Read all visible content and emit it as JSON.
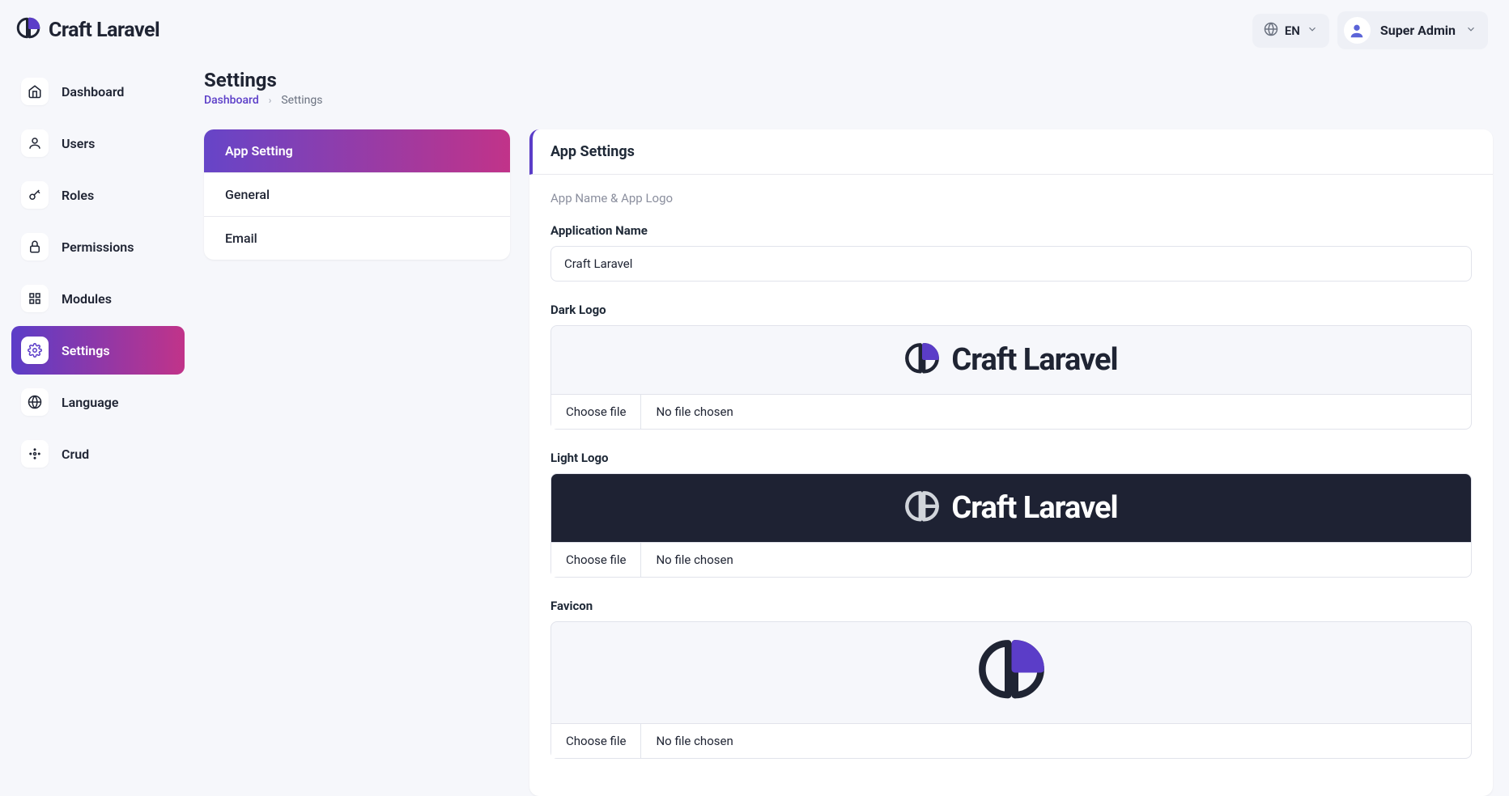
{
  "brand": {
    "name": "Craft Laravel"
  },
  "header": {
    "lang": "EN",
    "user_name": "Super Admin"
  },
  "sidebar": {
    "items": [
      {
        "label": "Dashboard"
      },
      {
        "label": "Users"
      },
      {
        "label": "Roles"
      },
      {
        "label": "Permissions"
      },
      {
        "label": "Modules"
      },
      {
        "label": "Settings"
      },
      {
        "label": "Language"
      },
      {
        "label": "Crud"
      }
    ]
  },
  "page": {
    "title": "Settings",
    "breadcrumb_root": "Dashboard",
    "breadcrumb_current": "Settings"
  },
  "subnav": {
    "items": [
      {
        "label": "App Setting"
      },
      {
        "label": "General"
      },
      {
        "label": "Email"
      }
    ]
  },
  "panel": {
    "title": "App Settings",
    "section_label": "App Name & App Logo",
    "app_name_label": "Application Name",
    "app_name_value": "Craft Laravel",
    "dark_logo_label": "Dark Logo",
    "light_logo_label": "Light Logo",
    "favicon_label": "Favicon",
    "choose_file": "Choose file",
    "no_file": "No file chosen",
    "preview_text": "Craft Laravel"
  },
  "colors": {
    "accent": "#5b3dc8",
    "accent2": "#c13389"
  }
}
